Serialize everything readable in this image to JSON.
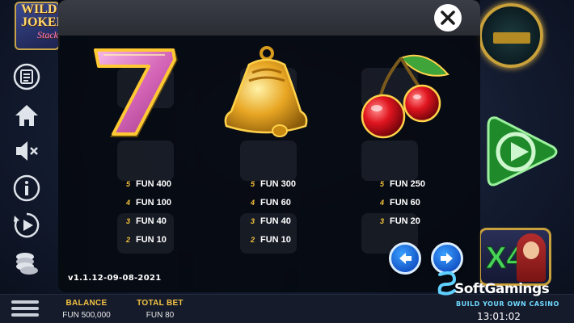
{
  "game": {
    "logo_lines": [
      "WILD",
      "JOKER",
      "Stacks"
    ]
  },
  "sidebar": {
    "items": [
      {
        "name": "paytable",
        "icon": "paytable-icon"
      },
      {
        "name": "home",
        "icon": "home-icon"
      },
      {
        "name": "sound",
        "icon": "sound-off-icon"
      },
      {
        "name": "info",
        "icon": "info-icon"
      },
      {
        "name": "autoplay",
        "icon": "autoplay-icon"
      },
      {
        "name": "bet",
        "icon": "coins-icon"
      }
    ]
  },
  "right_panel": {
    "multiplier_label": "X4",
    "spin_icon": "play-icon"
  },
  "paytable": {
    "close_icon": "close-icon",
    "symbols": [
      {
        "name": "seven",
        "icon": "seven-symbol",
        "payouts": [
          {
            "count": "5",
            "amount": "FUN 400"
          },
          {
            "count": "4",
            "amount": "FUN 100"
          },
          {
            "count": "3",
            "amount": "FUN 40"
          },
          {
            "count": "2",
            "amount": "FUN 10"
          }
        ]
      },
      {
        "name": "bell",
        "icon": "bell-symbol",
        "payouts": [
          {
            "count": "5",
            "amount": "FUN 300"
          },
          {
            "count": "4",
            "amount": "FUN 60"
          },
          {
            "count": "3",
            "amount": "FUN 40"
          },
          {
            "count": "2",
            "amount": "FUN 10"
          }
        ]
      },
      {
        "name": "cherry",
        "icon": "cherry-symbol",
        "payouts": [
          {
            "count": "5",
            "amount": "FUN 250"
          },
          {
            "count": "4",
            "amount": "FUN 60"
          },
          {
            "count": "3",
            "amount": "FUN 20"
          }
        ]
      }
    ],
    "version": "v1.1.12-09-08-2021",
    "prev_icon": "arrow-left-icon",
    "next_icon": "arrow-right-icon"
  },
  "bottom_bar": {
    "balance_label": "BALANCE",
    "balance_value": "FUN 500,000",
    "total_bet_label": "TOTAL BET",
    "total_bet_value": "FUN 80",
    "time": "13:01:02"
  },
  "watermark": {
    "brand": "SoftGamings",
    "tagline": "BUILD YOUR OWN CASINO"
  },
  "colors": {
    "accent_gold": "#f4c23a",
    "nav_blue": "#1f6fe0",
    "background": "#0d1424"
  }
}
